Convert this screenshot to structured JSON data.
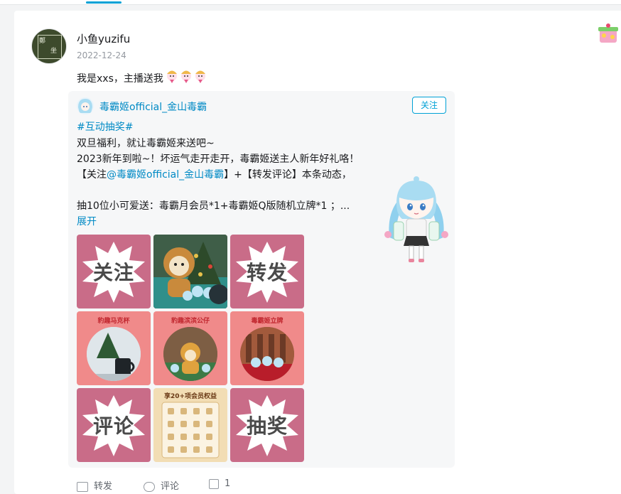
{
  "post": {
    "author": "小鱼yuzifu",
    "date": "2022-12-24",
    "text": "我是xxs，主播送我"
  },
  "repost": {
    "author": "毒霸姬official_金山毒霸",
    "follow_label": "关注",
    "hashtag": "#互动抽奖#",
    "line1": "双旦福利，就让毒霸姬来送吧~",
    "line2": "2023新年到啦~！坏运气走开走开，毒霸姬送主人新年好礼咯！",
    "line3_prefix": "【关注",
    "line3_mention": "@毒霸姬official_金山毒霸",
    "line3_suffix": "】+【转发评论】本条动态，",
    "line4": "抽10位小可爱送：毒霸月会员*1+毒霸姬Q版随机立牌*1 ；...",
    "expand_label": "展开",
    "images": [
      {
        "type": "text",
        "label": "关注"
      },
      {
        "type": "photo"
      },
      {
        "type": "text",
        "label": "转发"
      },
      {
        "type": "prize",
        "label": "豹趣马克杯"
      },
      {
        "type": "prize",
        "label": "豹趣滨滨公仔"
      },
      {
        "type": "prize",
        "label": "毒霸姬立牌"
      },
      {
        "type": "text",
        "label": "评论"
      },
      {
        "type": "benefits",
        "label": "享20+项会员权益"
      },
      {
        "type": "text",
        "label": "抽奖"
      }
    ]
  },
  "actions": {
    "forward": "转发",
    "comment": "评论",
    "like_count": "1"
  },
  "colors": {
    "accent": "#00a1d6",
    "link": "#008ac5",
    "pink_tile": "#c96c88"
  }
}
